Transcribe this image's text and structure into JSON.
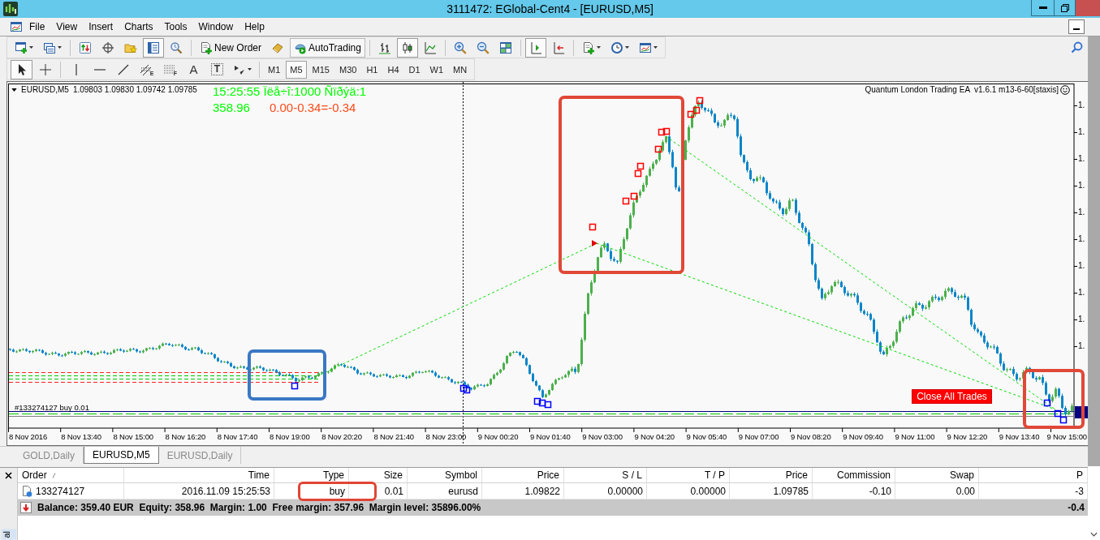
{
  "window": {
    "title": "3111472: EGlobal-Cent4 - [EURUSD,M5]"
  },
  "menu": [
    "File",
    "View",
    "Insert",
    "Charts",
    "Tools",
    "Window",
    "Help"
  ],
  "toolbar": [
    {
      "kind": "new-chart",
      "caret": true
    },
    {
      "kind": "profiles",
      "caret": true
    },
    {
      "kind": "separator"
    },
    {
      "kind": "market-watch",
      "on": false
    },
    {
      "kind": "data-window",
      "on": false
    },
    {
      "kind": "navigator",
      "on": false
    },
    {
      "kind": "terminal",
      "on": true
    },
    {
      "kind": "tester",
      "on": false
    },
    {
      "kind": "separator"
    },
    {
      "kind": "new-order",
      "label": "New Order"
    },
    {
      "kind": "meta-editor"
    },
    {
      "kind": "autotrading",
      "label": "AutoTrading",
      "on": true
    },
    {
      "kind": "separator"
    },
    {
      "kind": "bar-chart",
      "on": false
    },
    {
      "kind": "candlesticks",
      "on": true
    },
    {
      "kind": "line-chart",
      "on": false
    },
    {
      "kind": "separator"
    },
    {
      "kind": "zoom-in"
    },
    {
      "kind": "zoom-out"
    },
    {
      "kind": "tile-windows"
    },
    {
      "kind": "separator"
    },
    {
      "kind": "chart-shift",
      "on": true
    },
    {
      "kind": "auto-scroll",
      "on": false
    },
    {
      "kind": "separator"
    },
    {
      "kind": "indicators",
      "caret": true
    },
    {
      "kind": "periods",
      "caret": true
    },
    {
      "kind": "templates",
      "caret": true
    }
  ],
  "drawing_tools": [
    {
      "kind": "cursor",
      "selected": true
    },
    {
      "kind": "crosshair",
      "selected": false
    },
    {
      "kind": "separator"
    },
    {
      "kind": "vertical-line",
      "selected": false
    },
    {
      "kind": "horizontal-line",
      "selected": false
    },
    {
      "kind": "trend-line",
      "selected": false
    },
    {
      "kind": "channel",
      "glyph": "E",
      "selected": false
    },
    {
      "kind": "fibonacci",
      "glyph": "F",
      "selected": false
    },
    {
      "kind": "text",
      "glyph": "A",
      "selected": false
    },
    {
      "kind": "label",
      "glyph": "T",
      "selected": false
    },
    {
      "kind": "arrows",
      "caret": true,
      "selected": false
    }
  ],
  "timeframes": [
    {
      "label": "M1",
      "selected": false
    },
    {
      "label": "M5",
      "selected": true
    },
    {
      "label": "M15",
      "selected": false
    },
    {
      "label": "M30",
      "selected": false
    },
    {
      "label": "H1",
      "selected": false
    },
    {
      "label": "H4",
      "selected": false
    },
    {
      "label": "D1",
      "selected": false
    },
    {
      "label": "W1",
      "selected": false
    },
    {
      "label": "MN",
      "selected": false
    }
  ],
  "chart": {
    "symbol": "EURUSD,M5",
    "ohlc": "1.09803 1.09830 1.09742 1.09785",
    "status_line": "15:25:55 Ïëå÷î:1000 Ñïðýä:1",
    "equity": "358.96",
    "profit_formula": "0.00-0.34=-0.34",
    "expert_label": "Quantum London Trading EA  v1.6.1 m13-6-60[staxis]",
    "order_label": "#133274127 buy 0.01",
    "close_button": "Close All Trades",
    "price_axis": [
      "1.",
      "1.",
      "1.",
      "1.",
      "1.",
      "1.",
      "1.",
      "1.",
      "1.",
      "1."
    ],
    "time_axis": [
      "8 Nov 2016",
      "8 Nov 13:40",
      "8 Nov 15:00",
      "8 Nov 16:20",
      "8 Nov 17:40",
      "8 Nov 19:00",
      "8 Nov 20:20",
      "8 Nov 21:40",
      "8 Nov 23:00",
      "9 Nov 00:20",
      "9 Nov 01:40",
      "9 Nov 03:00",
      "9 Nov 04:20",
      "9 Nov 05:40",
      "9 Nov 07:00",
      "9 Nov 08:20",
      "9 Nov 09:40",
      "9 Nov 11:00",
      "9 Nov 12:20",
      "9 Nov 13:40",
      "9 Nov 15:00"
    ]
  },
  "chart_tabs": [
    {
      "label": "GOLD,Daily",
      "selected": false
    },
    {
      "label": "EURUSD,M5",
      "selected": true
    },
    {
      "label": "EURUSD,Daily",
      "selected": false
    }
  ],
  "terminal": {
    "side_label": "al",
    "columns": [
      {
        "label": "Order",
        "sorted": true
      },
      {
        "label": "Time",
        "sorted": false
      },
      {
        "label": "Type",
        "sorted": false
      },
      {
        "label": "Size",
        "sorted": false
      },
      {
        "label": "Symbol",
        "sorted": false
      },
      {
        "label": "Price",
        "sorted": false
      },
      {
        "label": "S / L",
        "sorted": false
      },
      {
        "label": "T / P",
        "sorted": false
      },
      {
        "label": "Price",
        "sorted": false
      },
      {
        "label": "Commission",
        "sorted": false
      },
      {
        "label": "Swap",
        "sorted": false
      },
      {
        "label": "P",
        "sorted": false
      }
    ],
    "rows": [
      {
        "cells": [
          "133274127",
          "2016.11.09 15:25:53",
          "buy",
          "0.01",
          "eurusd",
          "1.09822",
          "0.00000",
          "0.00000",
          "1.09785",
          "-0.10",
          "0.00",
          "-3"
        ]
      }
    ],
    "summary": {
      "text": "Balance: 359.40 EUR  Equity: 358.96  Margin: 1.00  Free margin: 357.96  Margin level: 35896.00%",
      "total": "-0.4"
    }
  }
}
